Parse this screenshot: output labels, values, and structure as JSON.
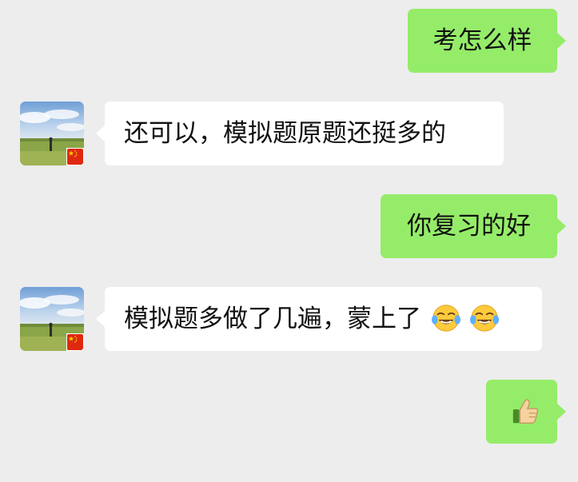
{
  "theme": {
    "background": "#ededed",
    "outgoing_bubble": "#95ec69",
    "incoming_bubble": "#ffffff"
  },
  "messages": [
    {
      "direction": "outgoing",
      "text": "考怎么样"
    },
    {
      "direction": "incoming",
      "avatar": "landscape-avatar-with-china-flag-badge",
      "text": "还可以，模拟题原题还挺多的"
    },
    {
      "direction": "outgoing",
      "text": "你复习的好"
    },
    {
      "direction": "incoming",
      "avatar": "landscape-avatar-with-china-flag-badge",
      "text": "模拟题多做了几遍，蒙上了",
      "emojis": [
        "face-with-tears-of-joy-icon",
        "face-with-tears-of-joy-icon"
      ]
    },
    {
      "direction": "outgoing",
      "text": "",
      "emojis": [
        "thumbs-up-icon"
      ]
    }
  ]
}
